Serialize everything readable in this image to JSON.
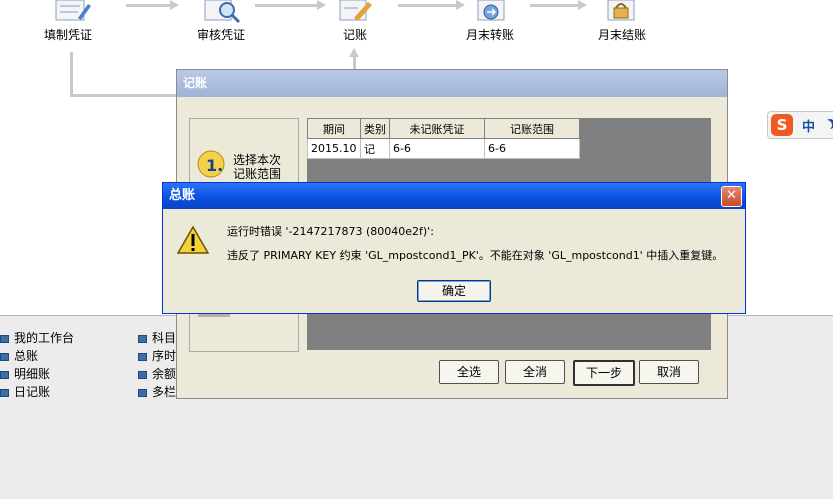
{
  "workflow": {
    "items": [
      {
        "label": "填制凭证",
        "icon": "fill-voucher-icon"
      },
      {
        "label": "审核凭证",
        "icon": "audit-voucher-icon"
      },
      {
        "label": "记账",
        "icon": "post-ledger-icon"
      },
      {
        "label": "月末转账",
        "icon": "month-end-transfer-icon"
      },
      {
        "label": "月末结账",
        "icon": "month-end-close-icon"
      }
    ]
  },
  "bottom_menu": {
    "col1": [
      "我的工作台",
      "总账",
      "明细账",
      "日记账"
    ],
    "col2": [
      "科目",
      "序时",
      "余额",
      "多栏"
    ]
  },
  "jizhang_window": {
    "title": "记账",
    "step_label": "选择本次记账范围",
    "step_number": "1.",
    "step_line1": "选择本次",
    "step_line2": "记账范围",
    "table": {
      "headers": [
        "期间",
        "类别",
        "未记账凭证",
        "记账范围"
      ],
      "rows": [
        [
          "2015.10",
          "记",
          "6-6",
          "6-6"
        ]
      ]
    },
    "buttons": {
      "select_all": "全选",
      "clear_all": "全消",
      "next": "下一步",
      "cancel": "取消"
    }
  },
  "error_dialog": {
    "title": "总账",
    "line1": "运行时错误 '-2147217873 (80040e2f)':",
    "line2": "违反了 PRIMARY KEY 约束 'GL_mpostcond1_PK'。不能在对象 'GL_mpostcond1' 中插入重复键。",
    "ok_label": "确定",
    "close_glyph": "✕"
  },
  "ime": {
    "logo": "S",
    "mode": "中"
  },
  "colors": {
    "title_blue": "#0a4ee0",
    "window_face": "#ece9d8",
    "grid_gray": "#808080"
  }
}
